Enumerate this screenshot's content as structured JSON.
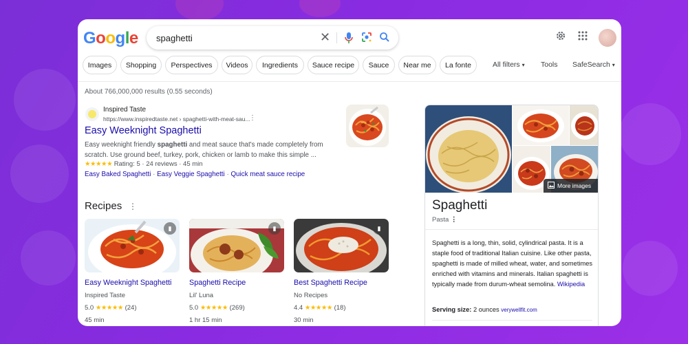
{
  "search": {
    "query": "spaghetti"
  },
  "chips": [
    "Images",
    "Shopping",
    "Perspectives",
    "Videos",
    "Ingredients",
    "Sauce recipe",
    "Sauce",
    "Near me",
    "La fonte"
  ],
  "tools": {
    "all_filters": "All filters",
    "tools": "Tools",
    "safesearch": "SafeSearch"
  },
  "results_stats": "About 766,000,000 results (0.55 seconds)",
  "result": {
    "site_name": "Inspired Taste",
    "url": "https://www.inspiredtaste.net › spaghetti-with-meat-sau...",
    "title": "Easy Weeknight Spaghetti",
    "snippet_pre": "Easy weeknight friendly ",
    "snippet_bold": "spaghetti",
    "snippet_post": " and meat sauce that's made completely from scratch. Use ground beef, turkey, pork, chicken or lamb to make this simple ...",
    "stars": "★★★★★",
    "rating": "Rating: 5 · 24 reviews · 45 min",
    "links": [
      "Easy Baked Spaghetti",
      "Easy Veggie Spaghetti",
      "Quick meat sauce recipe"
    ],
    "link_sep": " · "
  },
  "recipes": {
    "heading": "Recipes",
    "cards": [
      {
        "title": "Easy Weeknight Spaghetti",
        "source": "Inspired Taste",
        "score": "5.0",
        "stars": "★★★★★",
        "count": "(24)",
        "time": "45 min"
      },
      {
        "title": "Spaghetti Recipe",
        "source": "Lil' Luna",
        "score": "5.0",
        "stars": "★★★★★",
        "count": "(269)",
        "time": "1 hr 15 min"
      },
      {
        "title": "Best Spaghetti Recipe",
        "source": "No Recipes",
        "score": "4.4",
        "stars": "★★★★★",
        "count": "(18)",
        "time": "30 min"
      }
    ]
  },
  "knowledge_panel": {
    "more_images": "More images",
    "title": "Spaghetti",
    "subtitle": "Pasta",
    "description": "Spaghetti is a long, thin, solid, cylindrical pasta. It is a staple food of traditional Italian cuisine. Like other pasta, spaghetti is made of milled wheat, water, and sometimes enriched with vitamins and minerals. Italian spaghetti is typically made from durum-wheat semolina.",
    "wiki_link": "Wikipedia",
    "serving_label": "Serving size:",
    "serving_value": "2 ounces",
    "serving_source": "verywellfit.com"
  },
  "icons": {
    "clear": "close-icon",
    "mic": "microphone-icon",
    "lens": "lens-icon",
    "search": "search-icon",
    "settings": "gear-icon",
    "apps": "apps-grid-icon",
    "bookmark": "bookmark-icon",
    "image": "image-icon"
  },
  "colors": {
    "link": "#1a0dab",
    "star": "#fbbc05",
    "background": "#8a2be2"
  }
}
